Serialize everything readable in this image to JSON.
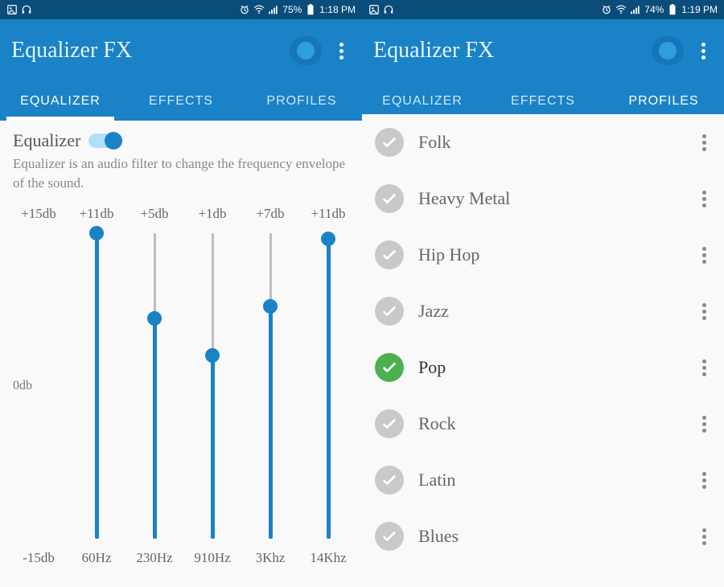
{
  "left": {
    "status": {
      "battery": "75%",
      "time": "1:18 PM"
    },
    "app_title": "Equalizer FX",
    "tabs": [
      {
        "label": "EQUALIZER",
        "active": true
      },
      {
        "label": "EFFECTS",
        "active": false
      },
      {
        "label": "PROFILES",
        "active": false
      }
    ],
    "eq_title": "Equalizer",
    "eq_description": "Equalizer is an audio filter to change the frequency envelope of the sound.",
    "zero_db_label": "0db",
    "bands": [
      {
        "db": "+15db",
        "freq": "60Hz",
        "value_pct": 100
      },
      {
        "db": "+11db",
        "freq": "230Hz",
        "value_pct": 72
      },
      {
        "db": "+5db",
        "freq": "910Hz",
        "value_pct": 60
      },
      {
        "db": "+1db",
        "freq": "3Khz",
        "value_pct": 76
      },
      {
        "db": "+7db",
        "freq": "14Khz",
        "value_pct": 98
      },
      {
        "db": "+11db",
        "freq": "",
        "value_pct": null
      }
    ],
    "min_db_label": "-15db"
  },
  "right": {
    "status": {
      "battery": "74%",
      "time": "1:19 PM"
    },
    "app_title": "Equalizer FX",
    "tabs": [
      {
        "label": "EQUALIZER",
        "active": false
      },
      {
        "label": "EFFECTS",
        "active": false
      },
      {
        "label": "PROFILES",
        "active": true
      }
    ],
    "profiles": [
      {
        "name": "Folk",
        "active": false
      },
      {
        "name": "Heavy Metal",
        "active": false
      },
      {
        "name": "Hip Hop",
        "active": false
      },
      {
        "name": "Jazz",
        "active": false
      },
      {
        "name": "Pop",
        "active": true
      },
      {
        "name": "Rock",
        "active": false
      },
      {
        "name": "Latin",
        "active": false
      },
      {
        "name": "Blues",
        "active": false
      }
    ]
  }
}
